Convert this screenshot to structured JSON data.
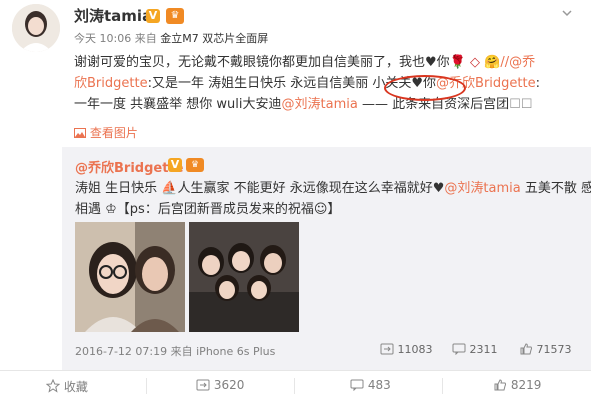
{
  "post": {
    "author": "刘涛tamia",
    "verified_badge": "V",
    "level_badge": "♛",
    "time": "今天 10:06",
    "from_prefix": "来自",
    "source": "金立M7 双芯片全面屏",
    "line1_a": "谢谢可爱的宝贝，无论戴不戴眼镜你都更加自信美丽了，我也",
    "line1_b": "你",
    "line1_c": "//",
    "line1_mention": "@乔",
    "line2_mention_tail": "欣Bridgette",
    "line2_a": ":又是一年 涛姐生日快乐 永远自信美丽 ",
    "line2_b": "小关关",
    "line2_c": "你",
    "line2_mention": "@乔欣Bridgette",
    "line2_d": ":",
    "line3_a": "一年一度 共襄盛举 想你 wuli大安迪",
    "line3_mention": "@刘涛tamia",
    "line3_b": " —— 此条来自资深后宫团",
    "view_pictures": "查看图片",
    "dropdown_icon": "chevron-down-icon"
  },
  "repost": {
    "author": "@乔欣Bridgette",
    "verified_badge": "V",
    "level_badge": "♛",
    "line1_a": "涛姐 生日快乐 ",
    "line1_b": "人生赢家 不能更好 永远像现在这么幸福就好",
    "line1_mention": "@刘涛tamia",
    "line1_c": " 五美不散 感谢",
    "line2": "相遇 ",
    "line2_b": "【ps：后宫团新晋成员发来的祝福",
    "line2_c": "】",
    "footer_time": "2016-7-12 07:19",
    "footer_from": "来自",
    "footer_source": "iPhone 6s Plus",
    "reposts": "11083",
    "comments": "2311",
    "likes": "71573"
  },
  "actions": {
    "favorite": "收藏",
    "repost": "3620",
    "comment": "483",
    "like": "8219"
  }
}
